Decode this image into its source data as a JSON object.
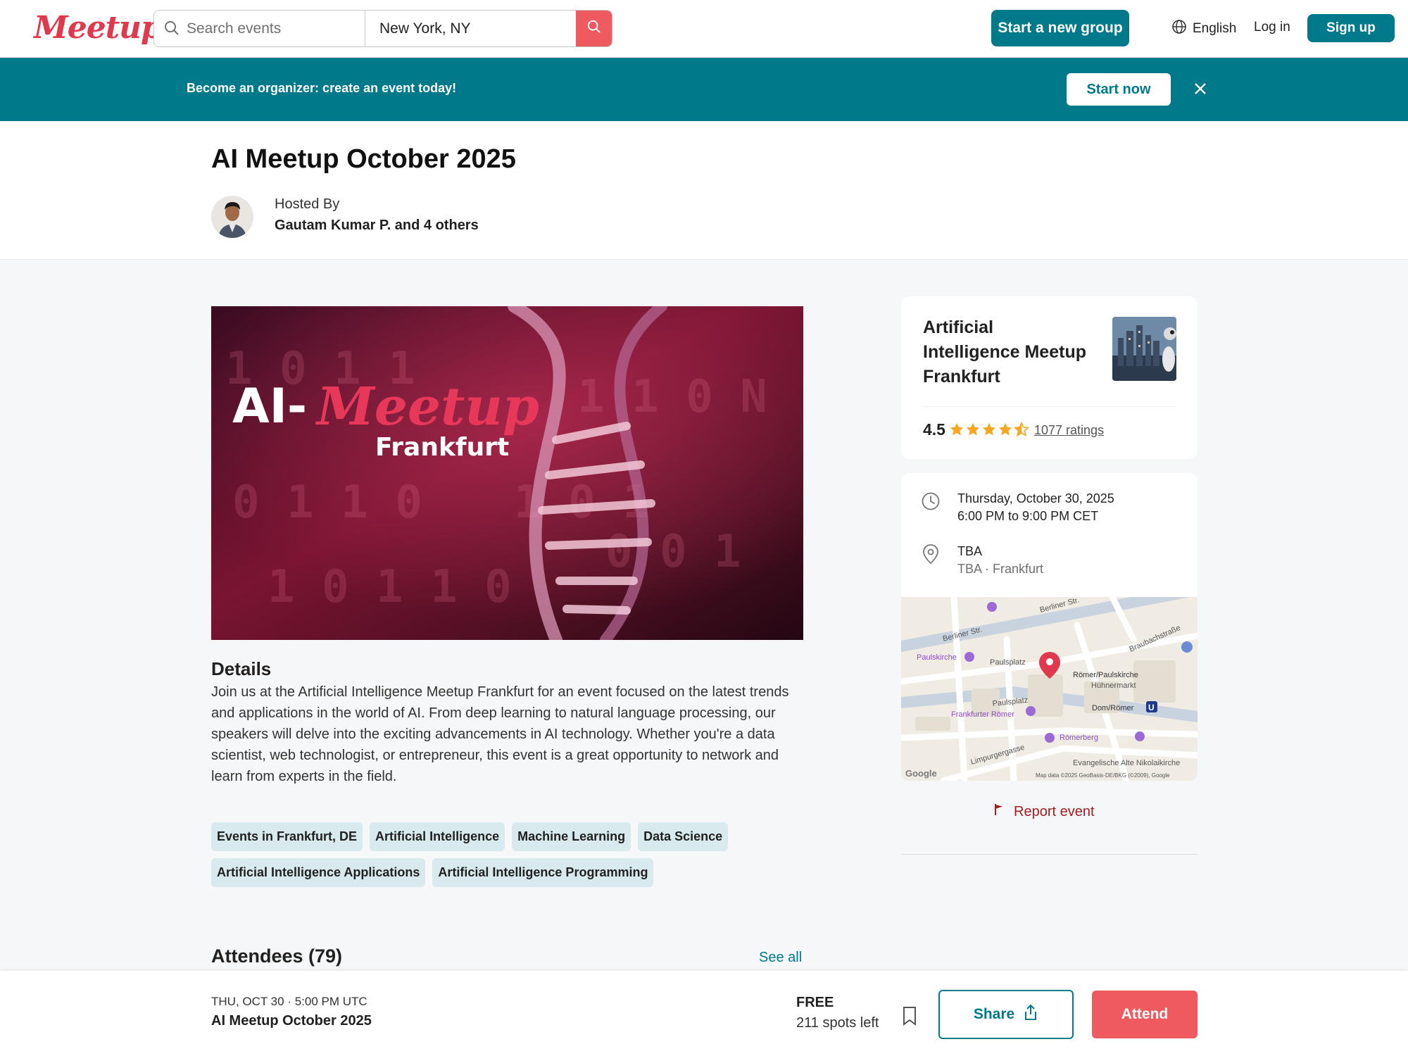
{
  "nav": {
    "logo": "Meetup",
    "search_placeholder": "Search events",
    "location": "New York, NY",
    "start_group": "Start a new group",
    "language": "English",
    "login": "Log in",
    "signup": "Sign up"
  },
  "banner": {
    "text": "Become an organizer: create an event today!",
    "cta": "Start now"
  },
  "event": {
    "title": "AI Meetup October 2025",
    "hosted_by_label": "Hosted By",
    "host": "Gautam Kumar P. and 4 others"
  },
  "hero": {
    "line1": "AI-",
    "line2": "Meetup",
    "line3": "Frankfurt"
  },
  "details": {
    "heading": "Details",
    "text": "Join us at the Artificial Intelligence Meetup Frankfurt for an event focused on the latest trends and applications in the world of AI. From deep learning to natural language processing, our speakers will delve into the exciting advancements in AI technology. Whether you're a data scientist, web technologist, or entrepreneur, this event is a great opportunity to network and learn from experts in the field."
  },
  "tags": [
    "Events in Frankfurt, DE",
    "Artificial Intelligence",
    "Machine Learning",
    "Data Science",
    "Artificial Intelligence Applications",
    "Artificial Intelligence Programming"
  ],
  "attendees": {
    "heading": "Attendees (79)",
    "see_all": "See all"
  },
  "group": {
    "name": "Artificial Intelligence Meetup Frankfurt",
    "rating": "4.5",
    "rating_value": 4.5,
    "ratings_count": "1077 ratings"
  },
  "when_where": {
    "date": "Thursday, October 30, 2025",
    "time": "6:00 PM to 9:00 PM CET",
    "venue": "TBA",
    "venue_sub": "TBA · Frankfurt"
  },
  "map": {
    "labels": [
      "Berliner Str.",
      "Berliner Str.",
      "Braubachstraße",
      "Paulskirche",
      "Paulsplatz",
      "Paulsplatz",
      "Römer/Paulskirche",
      "Hühnermarkt",
      "Dom/Römer",
      "Frankfurter Römer",
      "Römerberg",
      "Evangelische Alte Nikolaikirche",
      "Limpurgergasse"
    ],
    "attribution": "Map data ©2025 GeoBasis-DE/BKG (©2009), Google",
    "google": "Google"
  },
  "report": "Report event",
  "bottom_bar": {
    "date": "THU, OCT 30 · 5:00 PM UTC",
    "title": "AI Meetup October 2025",
    "price": "FREE",
    "spots": "211 spots left",
    "share": "Share",
    "attend": "Attend"
  },
  "colors": {
    "brand_red": "#e0384d",
    "teal": "#00798a",
    "attend_red": "#ef5a5f",
    "star": "#f5a623"
  },
  "icons": [
    "search-icon",
    "globe-icon",
    "close-icon",
    "star-icon",
    "clock-icon",
    "map-pin-icon",
    "flag-icon",
    "bookmark-icon",
    "share-icon"
  ]
}
